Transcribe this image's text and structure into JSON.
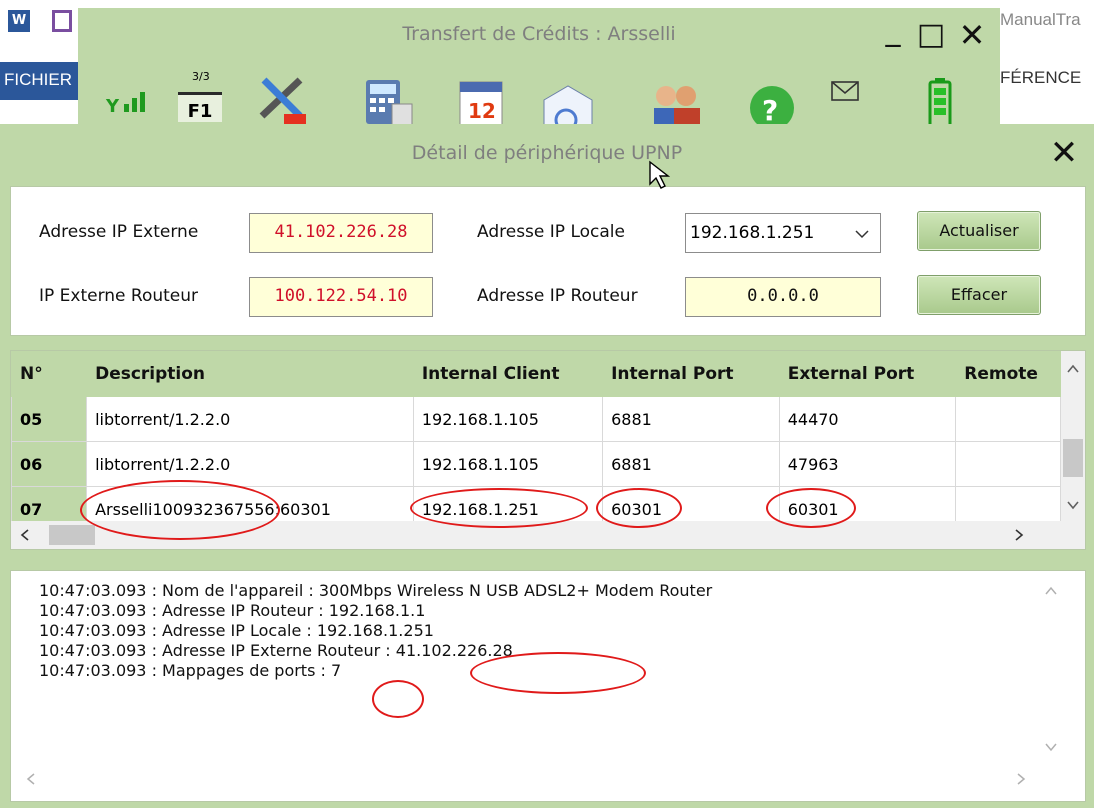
{
  "word": {
    "tab_file": "FICHIER",
    "tab_ref": "FÉRENCE",
    "doc_title_fragment": "ManualTra"
  },
  "transfer_window": {
    "title": "Transfert de Crédits : Arsselli",
    "minimize": "_",
    "maximize": "□",
    "close": "✕",
    "counter_top": "3/3",
    "counter_bottom": "F1"
  },
  "dialog": {
    "title": "Détail de périphérique UPNP",
    "close": "✕",
    "labels": {
      "external_ip": "Adresse IP Externe",
      "external_router_ip": "IP Externe Routeur",
      "local_ip": "Adresse IP Locale",
      "router_ip": "Adresse IP Routeur"
    },
    "values": {
      "external_ip": "41.102.226.28",
      "external_router_ip": "100.122.54.10",
      "local_ip_selected": "192.168.1.251",
      "router_ip": "0.0.0.0"
    },
    "buttons": {
      "refresh": "Actualiser",
      "clear": "Effacer"
    },
    "table": {
      "columns": [
        "N°",
        "Description",
        "Internal Client",
        "Internal Port",
        "External Port",
        "Remote"
      ],
      "rows": [
        [
          "05",
          "libtorrent/1.2.2.0",
          "192.168.1.105",
          "6881",
          "44470",
          ""
        ],
        [
          "06",
          "libtorrent/1.2.2.0",
          "192.168.1.105",
          "6881",
          "47963",
          ""
        ],
        [
          "07",
          "Arsselli100932367556:60301",
          "192.168.1.251",
          "60301",
          "60301",
          ""
        ]
      ]
    },
    "log": [
      "10:47:03.093 : Nom de l'appareil : 300Mbps Wireless N USB ADSL2+ Modem Router",
      "10:47:03.093 : Adresse IP Routeur : 192.168.1.1",
      "10:47:03.093 : Adresse IP Locale : 192.168.1.251",
      "10:47:03.093 : Adresse IP Externe Routeur : 41.102.226.28",
      "10:47:03.093 : Mappages de ports : 7"
    ]
  },
  "colors": {
    "window_green": "#bfd8a8",
    "field_yellow": "#ffffd8",
    "highlight_red": "#e01a1a",
    "ip_red": "#d0102a"
  }
}
